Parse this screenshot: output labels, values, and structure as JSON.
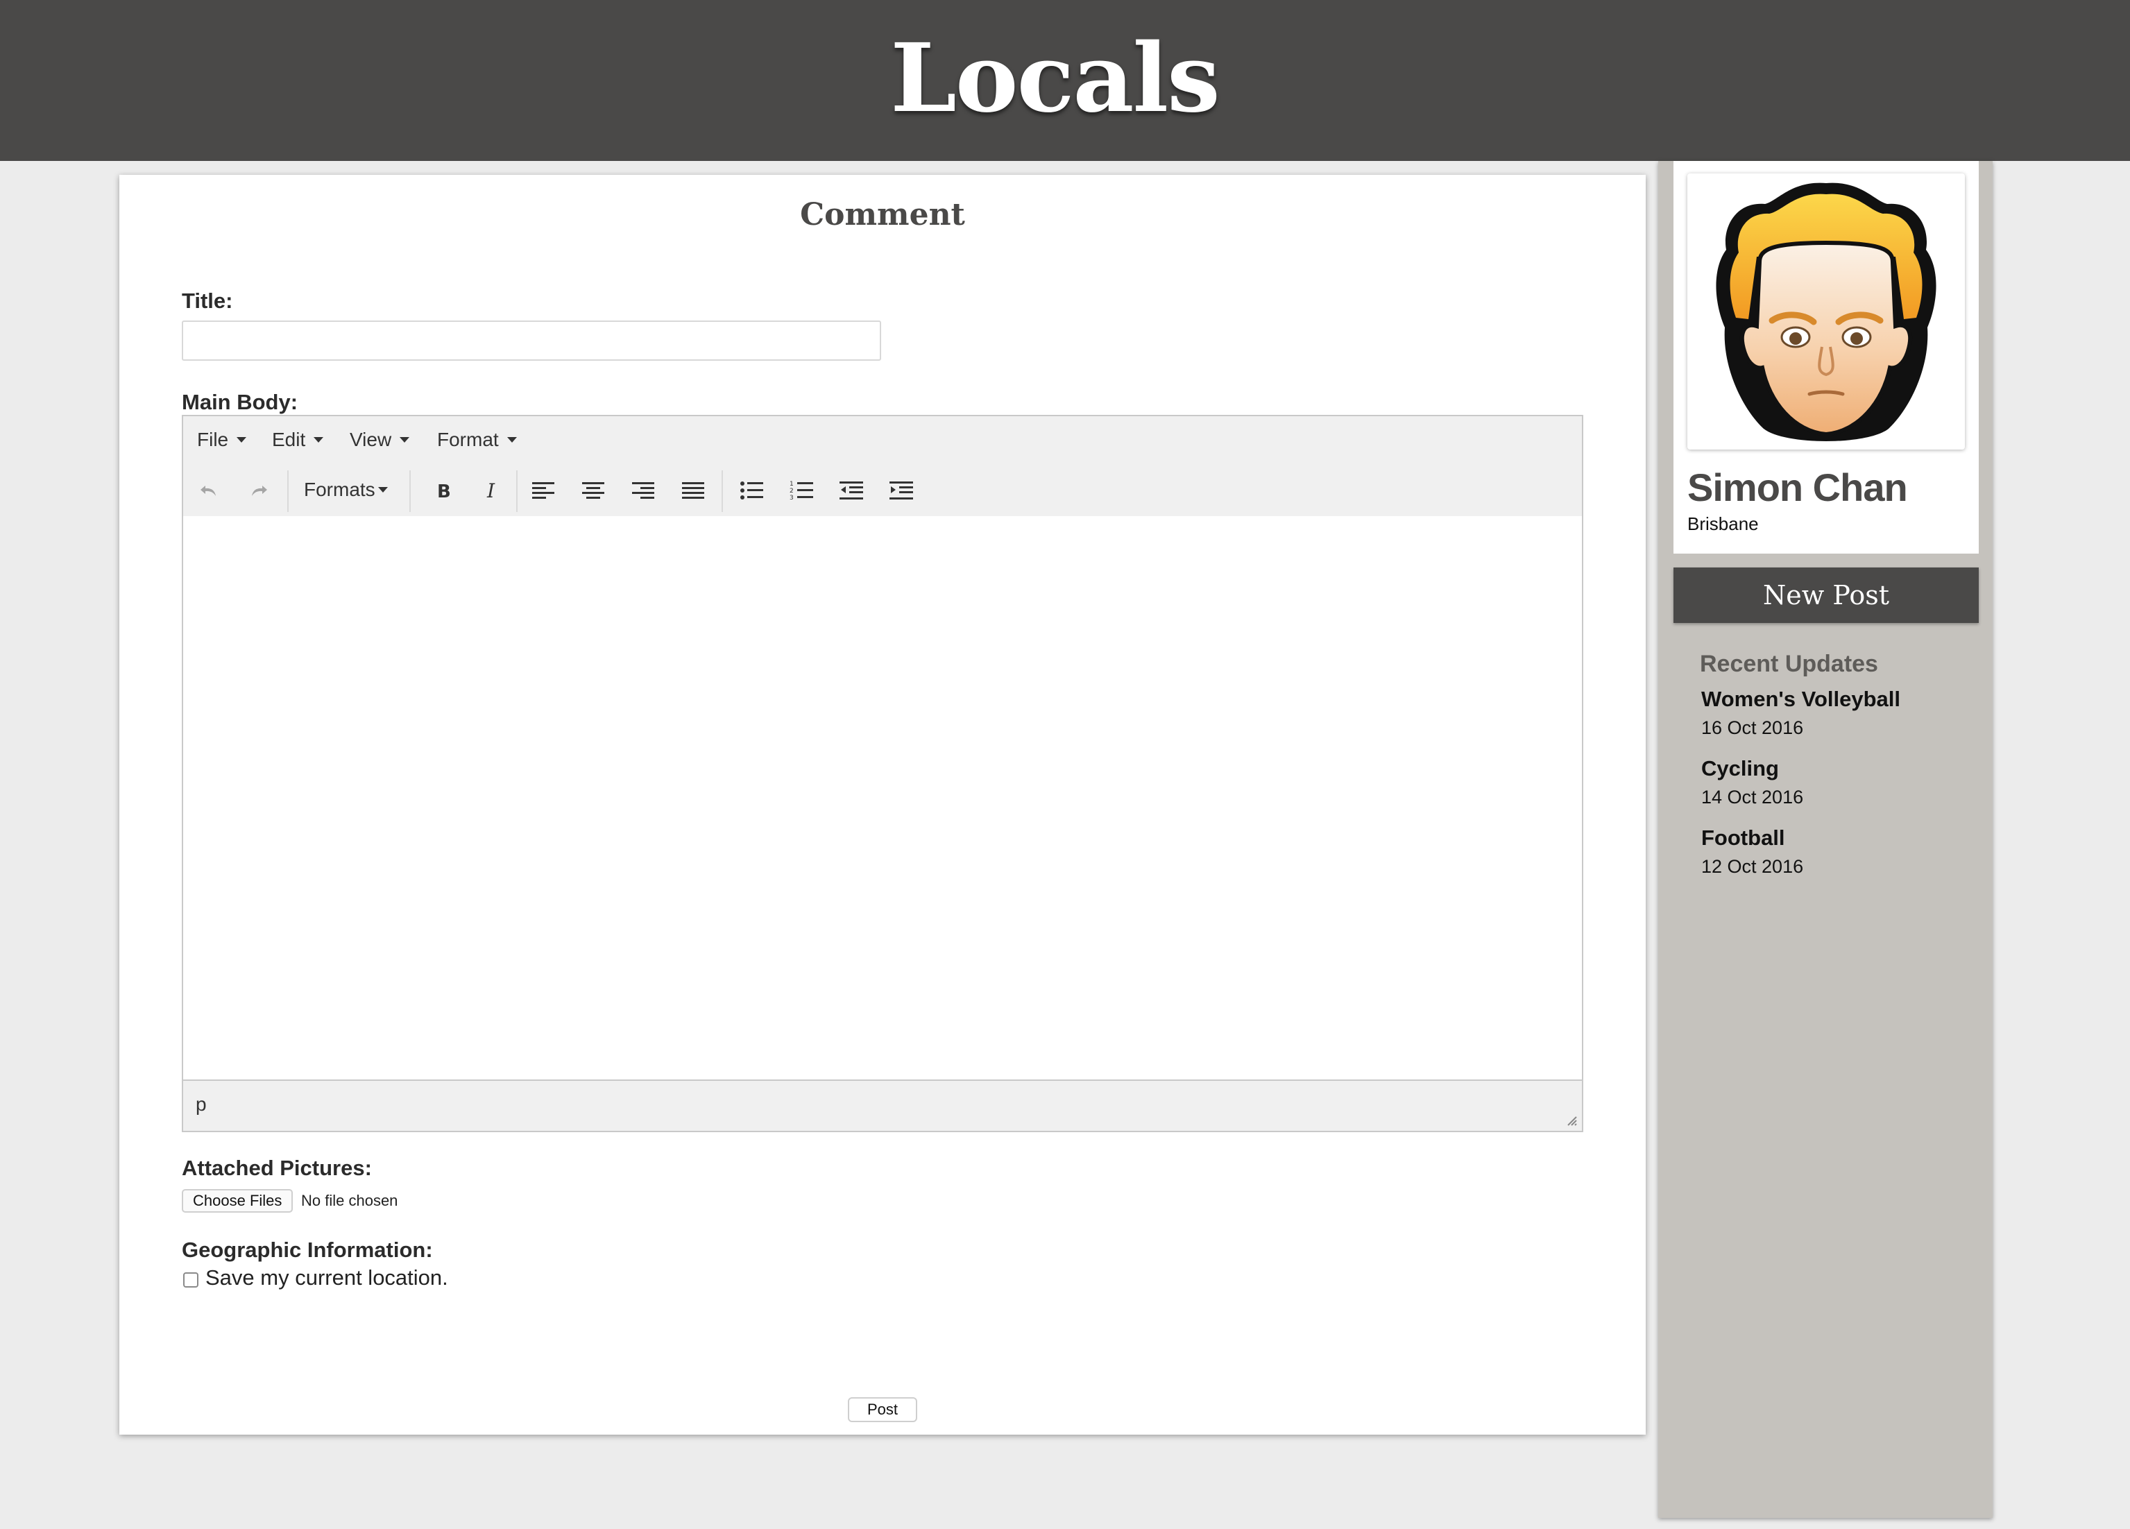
{
  "header": {
    "brand": "Locals"
  },
  "form": {
    "heading": "Comment",
    "title_label": "Title:",
    "title_value": "",
    "body_label": "Main Body:",
    "editor": {
      "menus": [
        "File",
        "Edit",
        "View",
        "Format"
      ],
      "formats_label": "Formats",
      "toolbar_icons": [
        "undo-icon",
        "redo-icon",
        "bold-icon",
        "italic-icon",
        "align-left-icon",
        "align-center-icon",
        "align-right-icon",
        "align-justify-icon",
        "bullet-list-icon",
        "numbered-list-icon",
        "outdent-icon",
        "indent-icon"
      ],
      "path": "p"
    },
    "attachments_label": "Attached Pictures:",
    "choose_files_label": "Choose Files",
    "file_status": "No file chosen",
    "geo_label": "Geographic Information:",
    "save_location_label": "Save my current location.",
    "save_location_checked": false,
    "post_label": "Post"
  },
  "sidebar": {
    "profile": {
      "name": "Simon Chan",
      "location": "Brisbane"
    },
    "new_post_label": "New Post",
    "recent_title": "Recent Updates",
    "updates": [
      {
        "title": "Women's Volleyball",
        "date": "16 Oct 2016"
      },
      {
        "title": "Cycling",
        "date": "14 Oct 2016"
      },
      {
        "title": "Football",
        "date": "12 Oct 2016"
      }
    ]
  },
  "colors": {
    "header_bg": "#4a4948",
    "page_bg": "#ececec",
    "sidebar_bg": "#c5c2bd",
    "button_dark": "#4a4948"
  }
}
